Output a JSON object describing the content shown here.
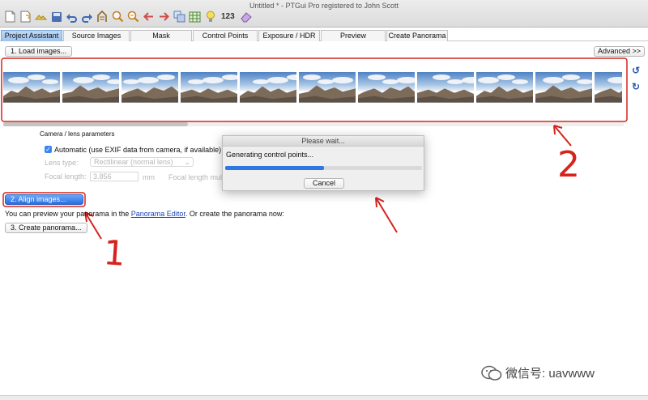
{
  "window": {
    "title": "Untitled * - PTGui Pro registered to John Scott",
    "toolbar_number_label": "123",
    "toolbar_icons": [
      "new-project-icon",
      "open-icon",
      "recent-icon",
      "save-icon",
      "undo-icon",
      "redo-icon",
      "control-points-icon",
      "zoom-in-icon",
      "zoom-out-icon",
      "previous-icon",
      "next-icon",
      "panorama-editor-icon",
      "table-icon",
      "bulb-icon",
      "numbering-icon",
      "eraser-icon"
    ]
  },
  "tabs": [
    {
      "id": "project-assistant",
      "label": "Project Assistant",
      "active": true
    },
    {
      "id": "source-images",
      "label": "Source Images"
    },
    {
      "id": "mask",
      "label": "Mask"
    },
    {
      "id": "control-points",
      "label": "Control Points"
    },
    {
      "id": "exposure-hdr",
      "label": "Exposure / HDR"
    },
    {
      "id": "preview",
      "label": "Preview"
    },
    {
      "id": "create-panorama",
      "label": "Create Panorama"
    }
  ],
  "assistant": {
    "load_images_label": "1. Load images...",
    "advanced_label": "Advanced >>",
    "image_count": 11,
    "camera_section_label": "Camera / lens parameters",
    "exif_checkbox_label": "Automatic (use EXIF data from camera, if available)",
    "exif_checked": true,
    "lens_type_label": "Lens type:",
    "lens_type_value": "Rectilinear (normal lens)",
    "focal_length_label": "Focal length:",
    "focal_length_value": "3.856",
    "focal_length_unit": "mm",
    "focal_multiplier_label": "Focal length multi",
    "align_images_label": "2. Align images...",
    "preview_text_before": "You can preview your panorama in the",
    "preview_link": "Panorama Editor",
    "preview_text_after": ". Or create the panorama now:",
    "create_panorama_label": "3. Create panorama..."
  },
  "dialog": {
    "title": "Please wait...",
    "message": "Generating control points...",
    "progress": 0.5,
    "cancel_label": "Cancel"
  },
  "annotations": {
    "label_one": "1",
    "label_two": "2",
    "color": "#d6231c"
  },
  "watermark": {
    "text": "微信号: uavwww"
  }
}
